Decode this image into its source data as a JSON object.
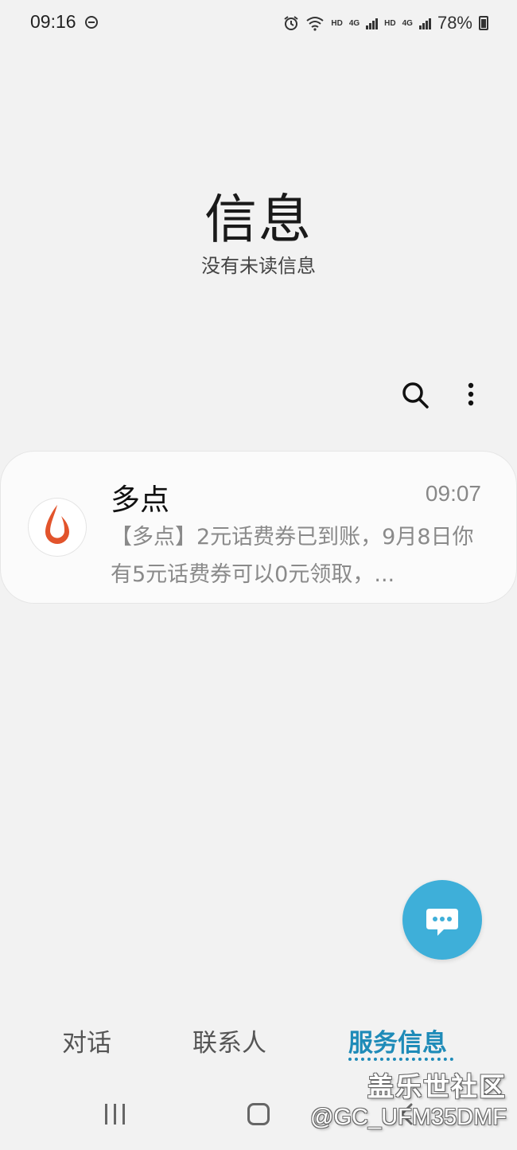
{
  "status_bar": {
    "time": "09:16",
    "net_label_1": "HD",
    "net_label_2": "4G",
    "net_label_3": "HD",
    "net_label_4": "4G",
    "battery_percent": "78%",
    "icons": [
      "do-not-disturb-icon",
      "alarm-icon",
      "wifi-icon",
      "signal-icon",
      "battery-icon"
    ]
  },
  "header": {
    "title": "信息",
    "subtitle": "没有未读信息"
  },
  "toolbar": {
    "icons": [
      "search-icon",
      "more-options-icon"
    ]
  },
  "conversations": [
    {
      "name": "多点",
      "time": "09:07",
      "preview": "【多点】2元话费券已到账，9月8日你有5元话费券可以0元领取，...",
      "avatar_color": "#e2542c"
    }
  ],
  "fab": {
    "icon": "compose-message-icon",
    "color": "#3eafd9"
  },
  "tabs": [
    {
      "label": "对话",
      "active": false
    },
    {
      "label": "联系人",
      "active": false
    },
    {
      "label": "服务信息",
      "active": true
    }
  ],
  "accent_color": "#1e8bb8",
  "nav_bar": {
    "icons": [
      "recents-icon",
      "home-icon",
      "back-icon"
    ]
  },
  "watermark": {
    "line1": "盖乐世社区",
    "line2": "@GC_UFM35DMF"
  }
}
